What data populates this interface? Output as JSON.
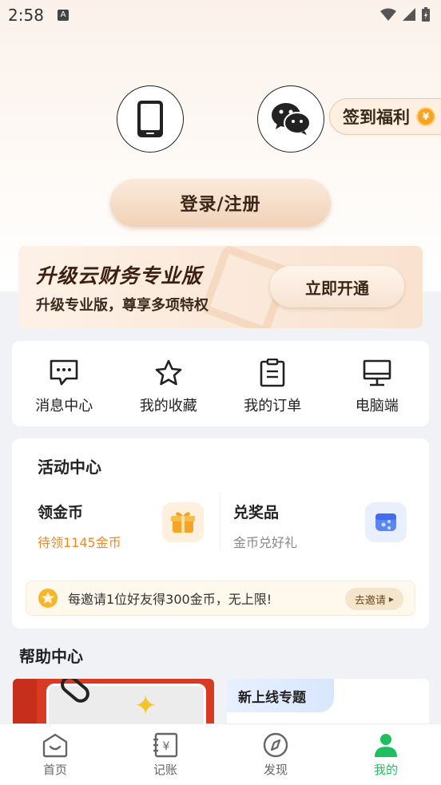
{
  "status_bar": {
    "time": "2:58",
    "notif_icon": "A"
  },
  "login": {
    "phone_icon": "phone-icon",
    "wechat_icon": "wechat-icon",
    "signin_label": "签到福利",
    "signin_coin": "¥",
    "login_button": "登录/注册"
  },
  "promo": {
    "title": "升级云财务专业版",
    "subtitle": "升级专业版，尊享多项特权",
    "button": "立即开通"
  },
  "quick_actions": [
    {
      "label": "消息中心",
      "icon": "message-icon"
    },
    {
      "label": "我的收藏",
      "icon": "star-icon"
    },
    {
      "label": "我的订单",
      "icon": "clipboard-icon"
    },
    {
      "label": "电脑端",
      "icon": "monitor-icon"
    }
  ],
  "activity": {
    "title": "活动中心",
    "left": {
      "title": "领金币",
      "subtitle": "待领1145金币",
      "icon": "gift-icon"
    },
    "right": {
      "title": "兑奖品",
      "subtitle": "金币兑好礼",
      "icon": "prize-icon"
    },
    "invite_text": "每邀请1位好友得300金币，无上限!",
    "invite_button": "去邀请"
  },
  "help": {
    "title": "帮助中心",
    "tag": "新上线专题"
  },
  "tabs": [
    {
      "label": "首页",
      "icon": "home-icon"
    },
    {
      "label": "记账",
      "icon": "ledger-icon"
    },
    {
      "label": "发现",
      "icon": "compass-icon"
    },
    {
      "label": "我的",
      "icon": "user-icon"
    }
  ],
  "colors": {
    "accent": "#1fbf5f",
    "coin_text": "#f08a1f"
  }
}
